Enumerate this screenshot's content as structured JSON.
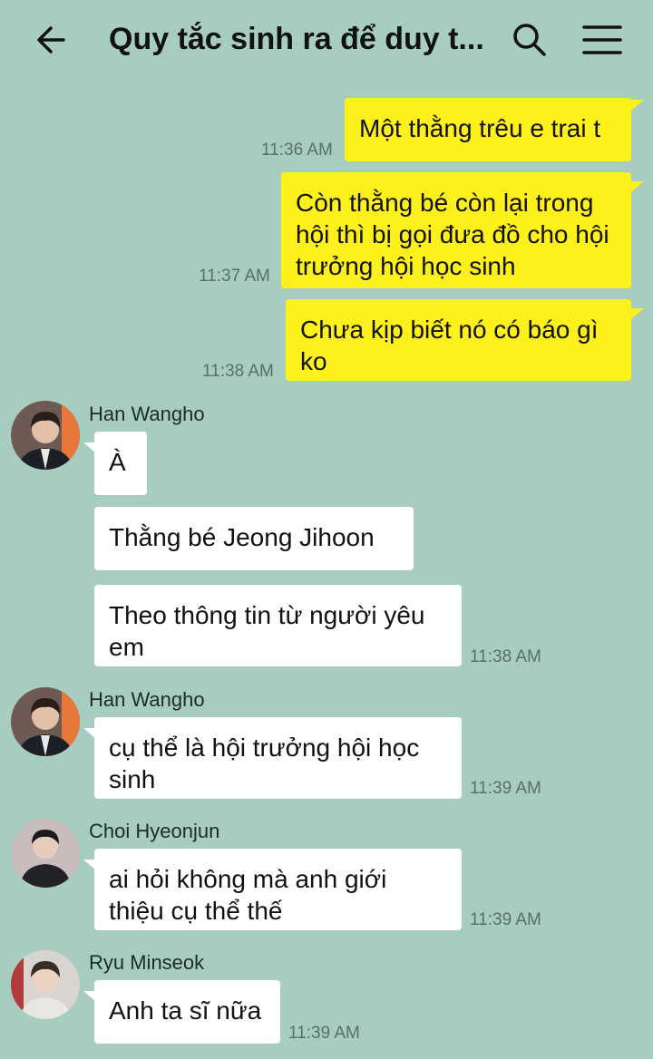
{
  "header": {
    "title": "Quy tắc sinh ra để duy t...",
    "icons": [
      "back-arrow-icon",
      "search-icon",
      "menu-icon"
    ]
  },
  "colors": {
    "background": "#a6cdbf",
    "my_bubble": "#fef01b",
    "their_bubble": "#ffffff"
  },
  "messages": {
    "m1": {
      "text": "Một thằng trêu e trai t",
      "time": "11:36 AM"
    },
    "m2": {
      "text": "Còn thằng bé còn lại trong hội thì bị gọi đưa đồ cho hội trưởng hội học sinh",
      "time": "11:37 AM"
    },
    "m3": {
      "text": "Chưa kịp biết nó có báo gì ko",
      "time": "11:38 AM"
    },
    "g1": {
      "sender": "Han Wangho",
      "b1": "À",
      "b2": "Thằng bé Jeong Jihoon",
      "b3": "Theo thông tin từ người yêu em",
      "time": "11:38 AM"
    },
    "g2": {
      "sender": "Han Wangho",
      "b1": "cụ thể là hội trưởng hội học sinh",
      "time": "11:39 AM"
    },
    "g3": {
      "sender": "Choi Hyeonjun",
      "b1": "ai hỏi không mà anh giới thiệu cụ thể thế",
      "time": "11:39 AM"
    },
    "g4": {
      "sender": "Ryu Minseok",
      "b1": "Anh ta sĩ nữa",
      "time": "11:39 AM"
    }
  }
}
